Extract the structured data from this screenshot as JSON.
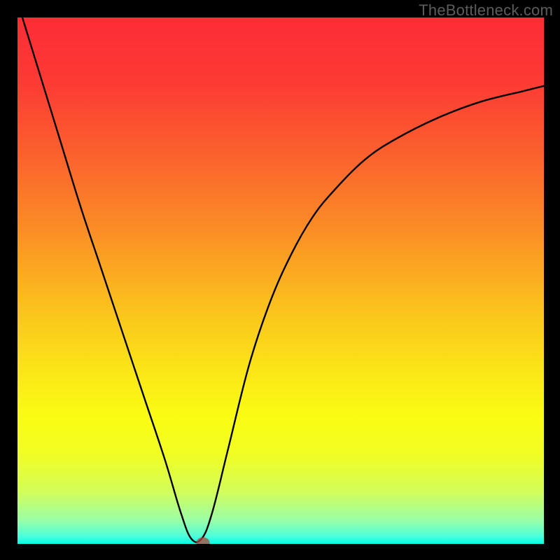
{
  "watermark": "TheBottleneck.com",
  "chart_data": {
    "type": "line",
    "title": "",
    "xlabel": "",
    "ylabel": "",
    "xlim": [
      0,
      100
    ],
    "ylim": [
      0,
      100
    ],
    "gradient_stops": [
      {
        "offset": 0,
        "color": "#fd2c36"
      },
      {
        "offset": 0.12,
        "color": "#fd3a34"
      },
      {
        "offset": 0.25,
        "color": "#fb5e2e"
      },
      {
        "offset": 0.4,
        "color": "#fb8c26"
      },
      {
        "offset": 0.55,
        "color": "#fbc11d"
      },
      {
        "offset": 0.68,
        "color": "#fbe817"
      },
      {
        "offset": 0.76,
        "color": "#fafd13"
      },
      {
        "offset": 0.83,
        "color": "#f1fd23"
      },
      {
        "offset": 0.9,
        "color": "#d3fd59"
      },
      {
        "offset": 0.955,
        "color": "#9bfea7"
      },
      {
        "offset": 0.985,
        "color": "#4ffeda"
      },
      {
        "offset": 1.0,
        "color": "#03ffe7"
      }
    ],
    "series": [
      {
        "name": "bottleneck-curve",
        "x": [
          0,
          4,
          8,
          12,
          16,
          20,
          24,
          28,
          31,
          33,
          35,
          37,
          40,
          44,
          48,
          52,
          56,
          60,
          66,
          72,
          80,
          88,
          96,
          100
        ],
        "y": [
          103,
          90,
          77,
          64,
          52,
          40,
          28,
          16,
          6,
          1,
          1,
          6,
          18,
          34,
          46,
          55,
          62,
          67,
          73,
          77,
          81,
          84,
          86,
          87
        ]
      }
    ],
    "annotations": [
      {
        "name": "optimum-marker",
        "x": 35.2,
        "y": 0.2
      }
    ]
  }
}
